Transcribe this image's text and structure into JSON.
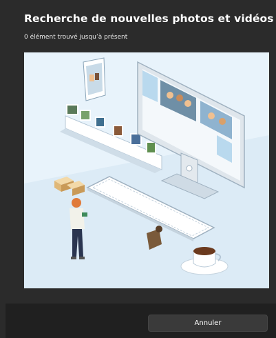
{
  "dialog": {
    "title": "Recherche de nouvelles photos et vidéos",
    "status": "0 élément trouvé jusqu’à présent",
    "cancel_label": "Annuler"
  },
  "colors": {
    "background": "#2b2b2b",
    "footer": "#202020",
    "illustration_bg": "#e8f3fb",
    "button": "#3a3a3a"
  }
}
